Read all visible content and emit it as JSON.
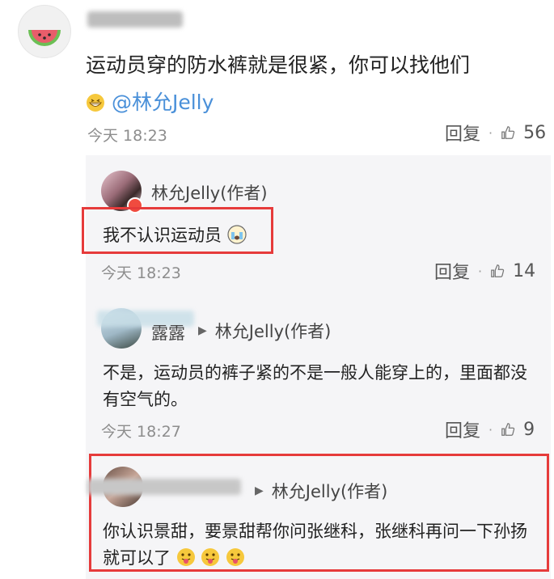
{
  "main_comment": {
    "text_line1": "运动员穿的防水裤就是很紧，你可以找他们",
    "mention": "@林允Jelly",
    "time": "今天 18:23",
    "reply_label": "回复",
    "dot": "·",
    "like_count": "56"
  },
  "replies": [
    {
      "author": "林允Jelly(作者)",
      "text": "我不认识运动员",
      "time": "今天 18:23",
      "reply_label": "回复",
      "dot": "·",
      "like_count": "14"
    },
    {
      "author_partial": "露露",
      "target": "林允Jelly(作者)",
      "text": "不是，运动员的裤子紧的不是一般人能穿上的，里面都没有空气的。",
      "time": "今天 18:27",
      "reply_label": "回复",
      "dot": "·",
      "like_count": "9"
    },
    {
      "target": "林允Jelly(作者)",
      "text": "你认识景甜，要景甜帮你问张继科，张继科再问一下孙扬就可以了"
    }
  ],
  "colors": {
    "link": "#4a90d9",
    "highlight_border": "#e63b3b",
    "reply_background": "#f5f5f7"
  }
}
